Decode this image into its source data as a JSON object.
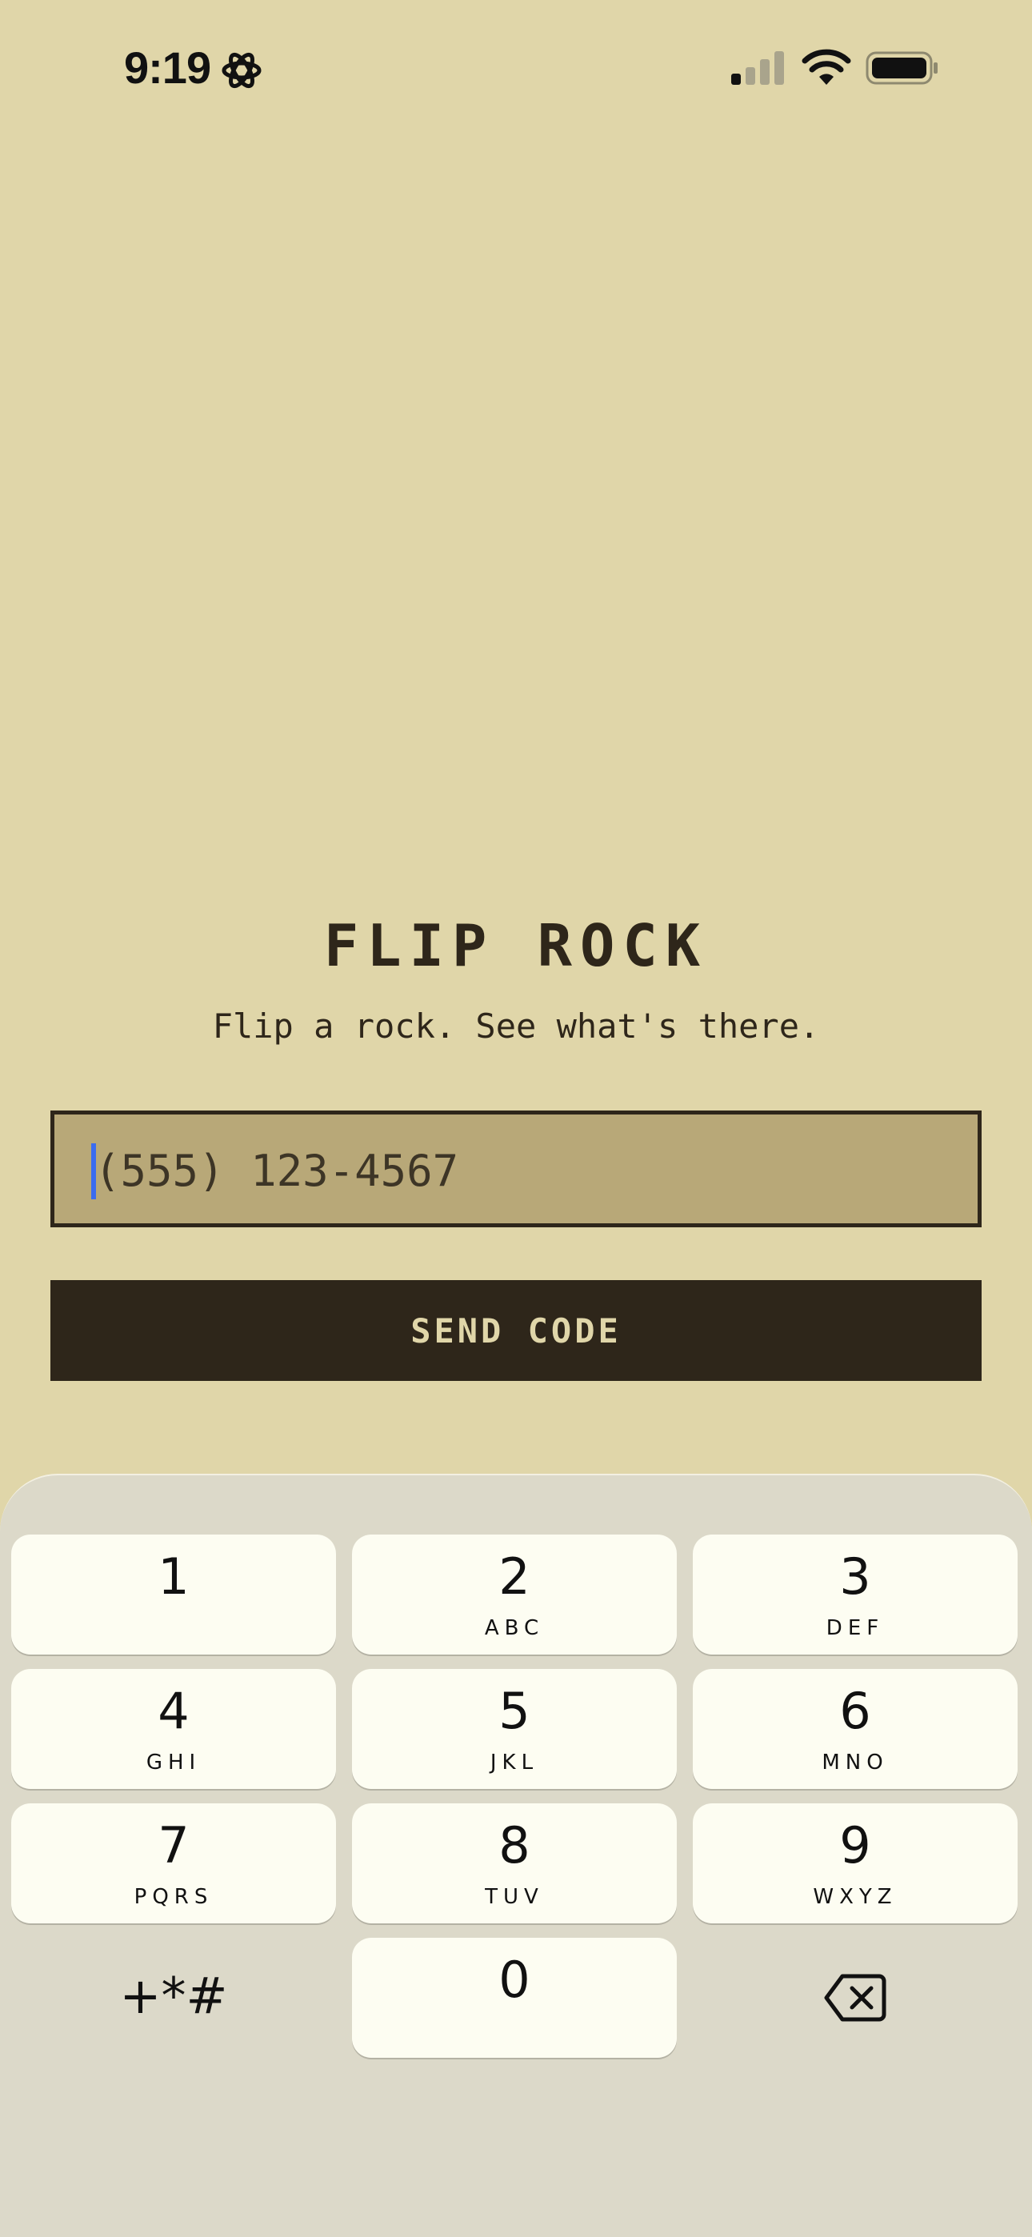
{
  "status_bar": {
    "time": "9:19",
    "icons": {
      "left": "gear-icon",
      "signal": "cellular-signal-icon",
      "wifi": "wifi-icon",
      "battery": "battery-icon"
    }
  },
  "app": {
    "title": "FLIP ROCK",
    "tagline": "Flip a rock. See what's there.",
    "phone_placeholder": "(555) 123-4567",
    "phone_value": "",
    "send_button": "SEND CODE"
  },
  "colors": {
    "background": "#e0d6a9",
    "field": "#b8a878",
    "ink": "#2e261a",
    "cursor": "#3b6cf0",
    "keyboard": "#dcd9c9",
    "key": "#fdfdf2"
  },
  "keypad": {
    "keys": [
      {
        "digit": "1",
        "letters": ""
      },
      {
        "digit": "2",
        "letters": "ABC"
      },
      {
        "digit": "3",
        "letters": "DEF"
      },
      {
        "digit": "4",
        "letters": "GHI"
      },
      {
        "digit": "5",
        "letters": "JKL"
      },
      {
        "digit": "6",
        "letters": "MNO"
      },
      {
        "digit": "7",
        "letters": "PQRS"
      },
      {
        "digit": "8",
        "letters": "TUV"
      },
      {
        "digit": "9",
        "letters": "WXYZ"
      },
      {
        "digit": "0",
        "letters": ""
      }
    ],
    "symbols": "+*#",
    "delete_icon": "delete-backspace-icon"
  }
}
